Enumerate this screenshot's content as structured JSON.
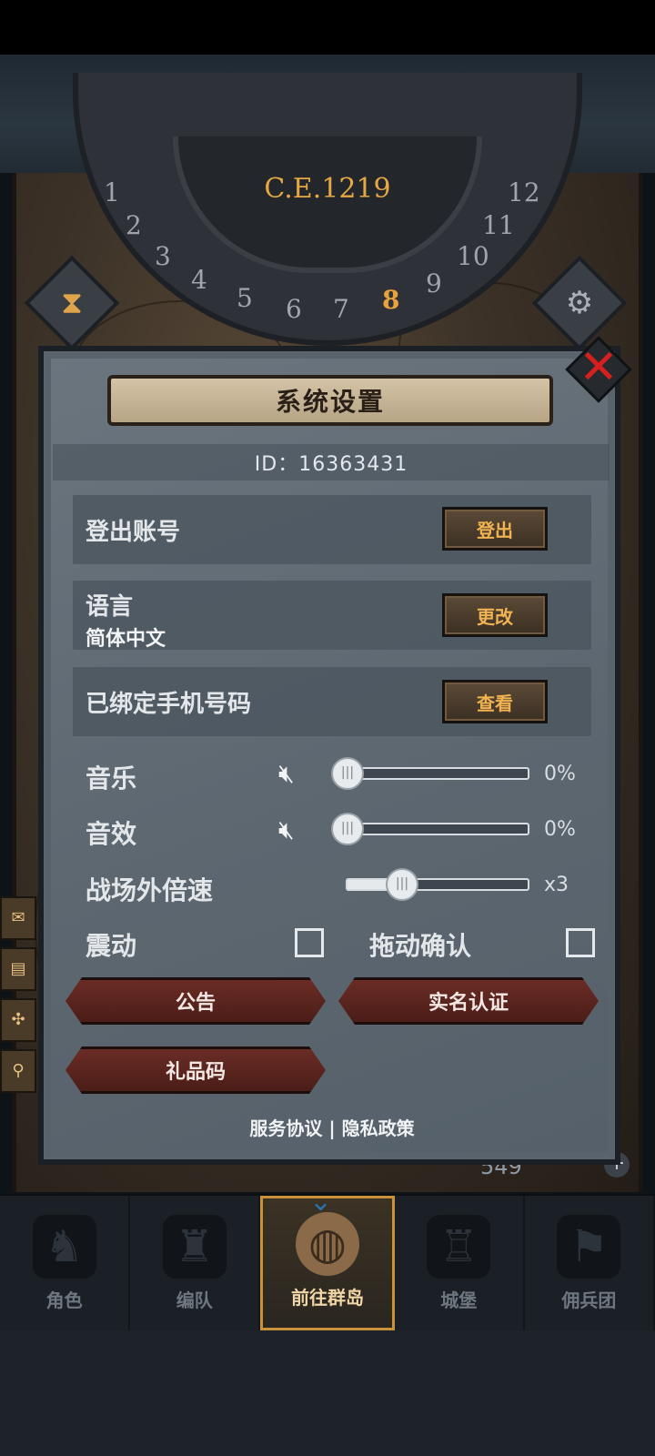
{
  "game": {
    "era": "C.E.1219",
    "dial_numbers": [
      "1",
      "2",
      "3",
      "4",
      "5",
      "6",
      "7",
      "8",
      "9",
      "10",
      "11",
      "12"
    ],
    "active_month": "8",
    "resource_count": "549"
  },
  "dialog": {
    "title": "系统设置",
    "id_text": "ID：16363431",
    "logout": {
      "label": "登出账号",
      "button": "登出"
    },
    "language": {
      "label": "语言",
      "value": "简体中文",
      "button": "更改"
    },
    "phone": {
      "label": "已绑定手机号码",
      "button": "查看"
    },
    "music": {
      "label": "音乐",
      "value": "0%",
      "level": 0
    },
    "sfx": {
      "label": "音效",
      "value": "0%",
      "level": 0
    },
    "speed": {
      "label": "战场外倍速",
      "value": "x3"
    },
    "vibration": {
      "label": "震动",
      "checked": false
    },
    "drag_confirm": {
      "label": "拖动确认",
      "checked": false
    },
    "buttons": {
      "notice": "公告",
      "realname": "实名认证",
      "gift_code": "礼品码"
    },
    "footer": {
      "service": "服务协议",
      "separator": "|",
      "privacy": "隐私政策"
    }
  },
  "bottom_nav": [
    {
      "label": "角色",
      "icon": "knight-helmet-icon"
    },
    {
      "label": "编队",
      "icon": "formation-helmet-icon"
    },
    {
      "label": "前往群岛",
      "icon": "globe-island-icon",
      "active": true
    },
    {
      "label": "城堡",
      "icon": "castle-icon"
    },
    {
      "label": "佣兵团",
      "icon": "mercenary-banner-icon"
    }
  ],
  "colors": {
    "accent_gold": "#f1b251",
    "close_red": "#d5201d",
    "active_month": "#e9a23b",
    "dialog_bg": "#5d6770"
  }
}
